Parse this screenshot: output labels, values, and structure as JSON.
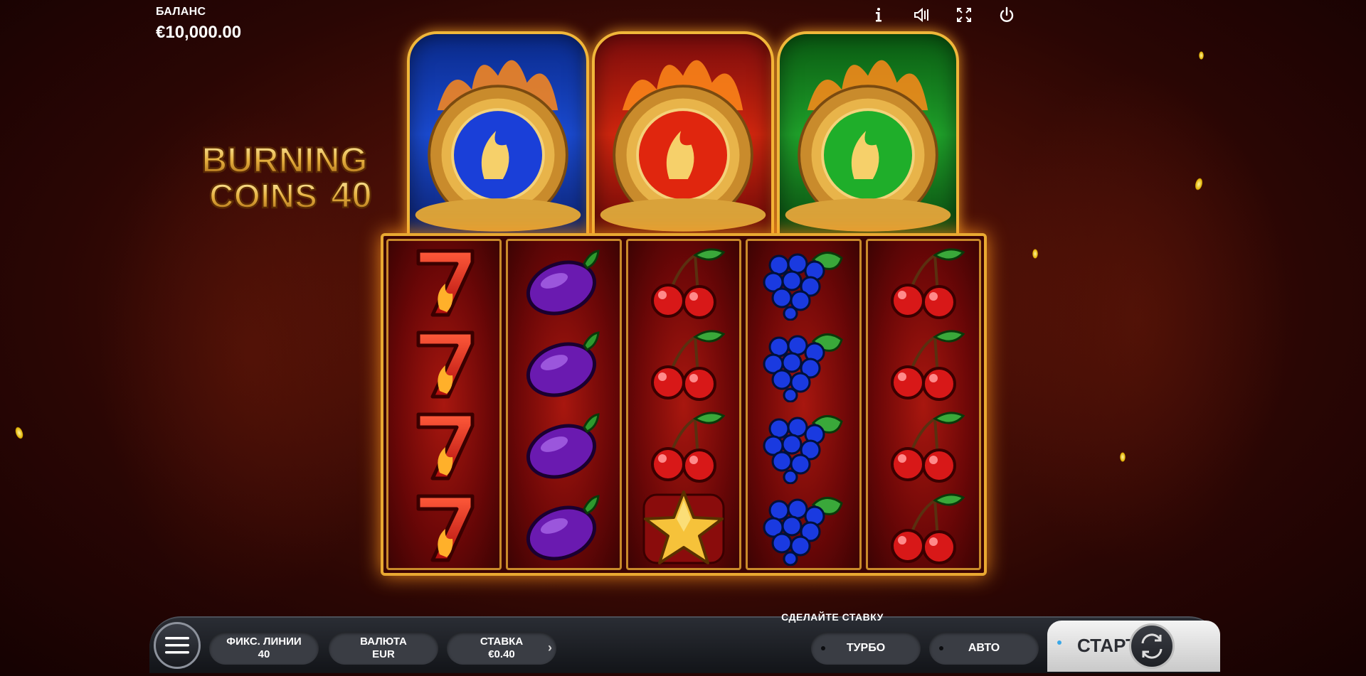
{
  "balance": {
    "label": "БАЛАНС",
    "value": "€10,000.00"
  },
  "top_icons": [
    "info-icon",
    "sound-icon",
    "fullscreen-icon",
    "power-icon"
  ],
  "logo": {
    "line1": "BURNING",
    "line2": "COINS",
    "number": "40"
  },
  "coin_panels": [
    {
      "color": "#1a4ad0",
      "name": "blue"
    },
    {
      "color": "#d0260e",
      "name": "red"
    },
    {
      "color": "#1fa02a",
      "name": "green"
    }
  ],
  "reels": [
    [
      "seven",
      "seven",
      "seven",
      "seven"
    ],
    [
      "plum",
      "plum",
      "plum",
      "plum"
    ],
    [
      "cherry",
      "cherry",
      "cherry",
      "star"
    ],
    [
      "grapes",
      "grapes",
      "grapes",
      "grapes"
    ],
    [
      "cherry",
      "cherry",
      "cherry",
      "cherry"
    ]
  ],
  "bar": {
    "prompt": "СДЕЛАЙТЕ СТАВКУ",
    "lines_label": "ФИКС. ЛИНИИ",
    "lines_value": "40",
    "currency_label": "ВАЛЮТА",
    "currency_value": "EUR",
    "bet_label": "СТАВКА",
    "bet_value": "€0.40",
    "turbo_label": "ТУРБО",
    "auto_label": "АВТО",
    "start_label": "СТАРТ"
  }
}
